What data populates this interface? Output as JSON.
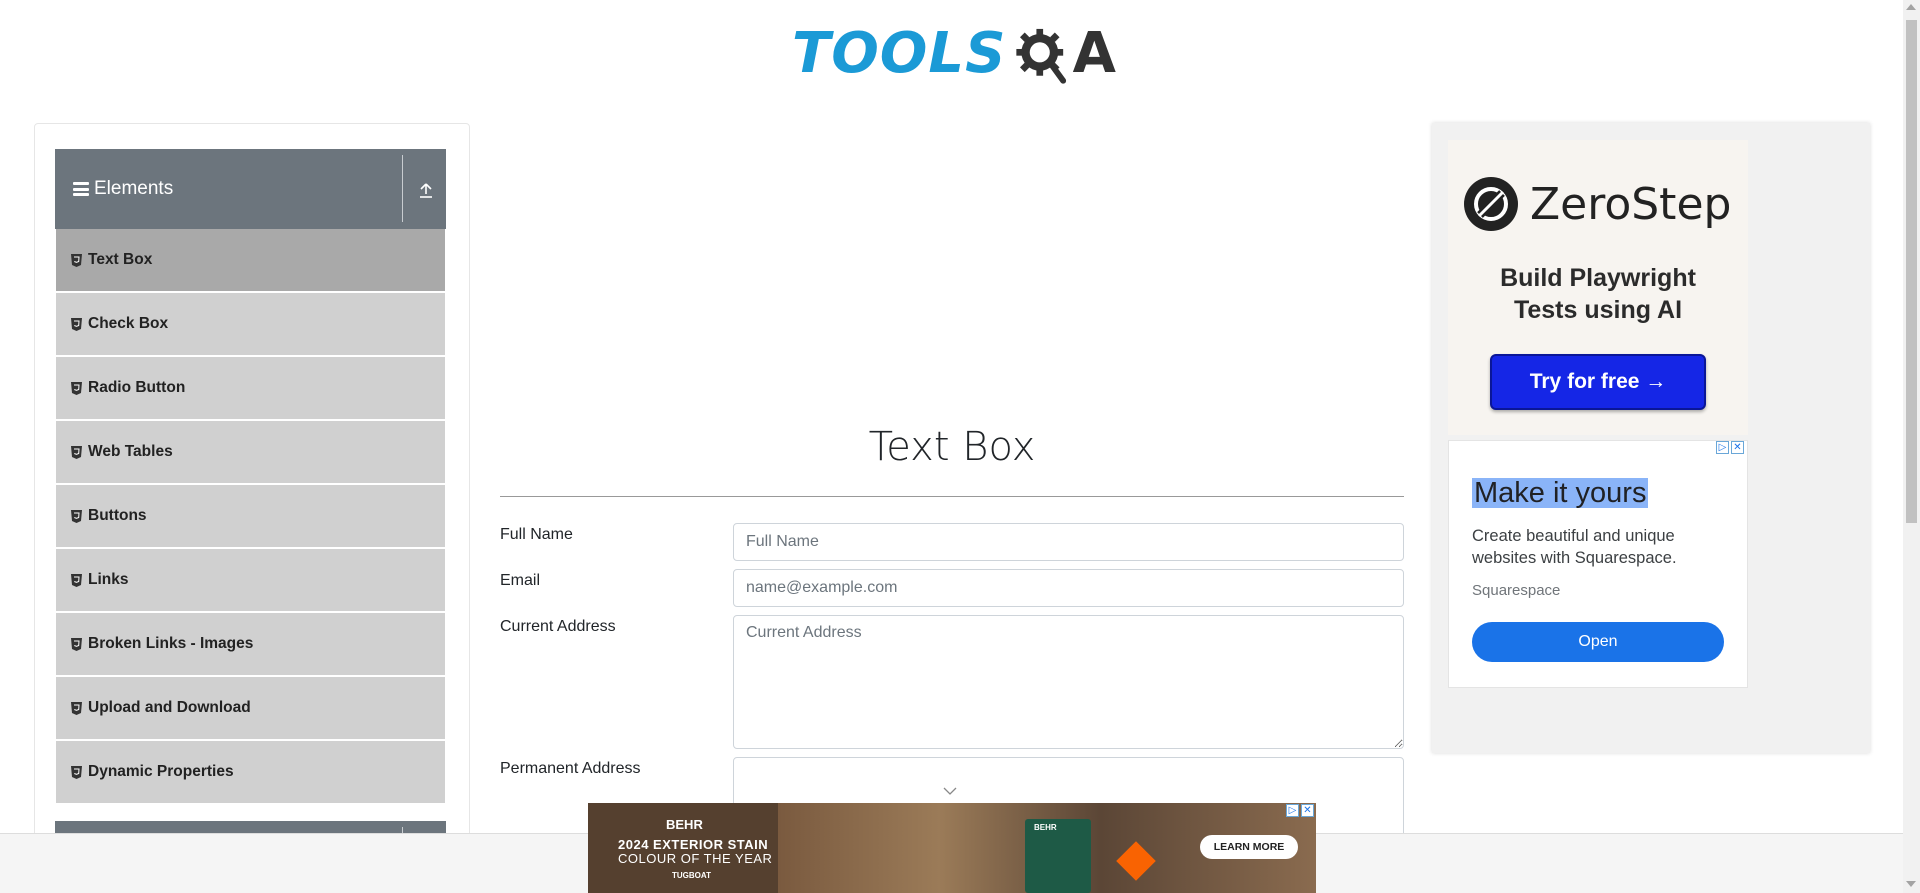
{
  "header": {
    "logo_text": "TOOLS",
    "logo_suffix": "A"
  },
  "sidebar": {
    "group_title": "Elements",
    "items": [
      {
        "label": "Text Box",
        "active": true
      },
      {
        "label": "Check Box"
      },
      {
        "label": "Radio Button"
      },
      {
        "label": "Web Tables"
      },
      {
        "label": "Buttons"
      },
      {
        "label": "Links"
      },
      {
        "label": "Broken Links - Images"
      },
      {
        "label": "Upload and Download"
      },
      {
        "label": "Dynamic Properties"
      }
    ]
  },
  "main": {
    "title": "Text Box",
    "form": {
      "full_name_label": "Full Name",
      "full_name_placeholder": "Full Name",
      "email_label": "Email",
      "email_placeholder": "name@example.com",
      "current_address_label": "Current Address",
      "current_address_placeholder": "Current Address",
      "permanent_address_label": "Permanent Address"
    }
  },
  "ads": {
    "zerostep": {
      "brand": "ZeroStep",
      "tagline_1": "Build Playwright",
      "tagline_2": "Tests using AI",
      "cta": "Try for free →"
    },
    "squarespace": {
      "headline": "Make it yours",
      "body": "Create beautiful and unique websites with Squarespace.",
      "brand": "Squarespace",
      "cta": "Open"
    },
    "behr": {
      "brand": "BEHR",
      "line1": "2024 EXTERIOR STAIN",
      "line2": "COLOUR OF THE YEAR",
      "line3": "TUGBOAT",
      "can_label": "BEHR",
      "cta": "LEARN MORE"
    }
  },
  "colors": {
    "brand_blue": "#1b9ad6",
    "sidebar_header": "#6c757d",
    "menu_item": "#d0d0d0",
    "menu_item_active": "#a9a9a9",
    "zerostep_button": "#1526e6",
    "squarespace_button": "#1a73e8"
  }
}
